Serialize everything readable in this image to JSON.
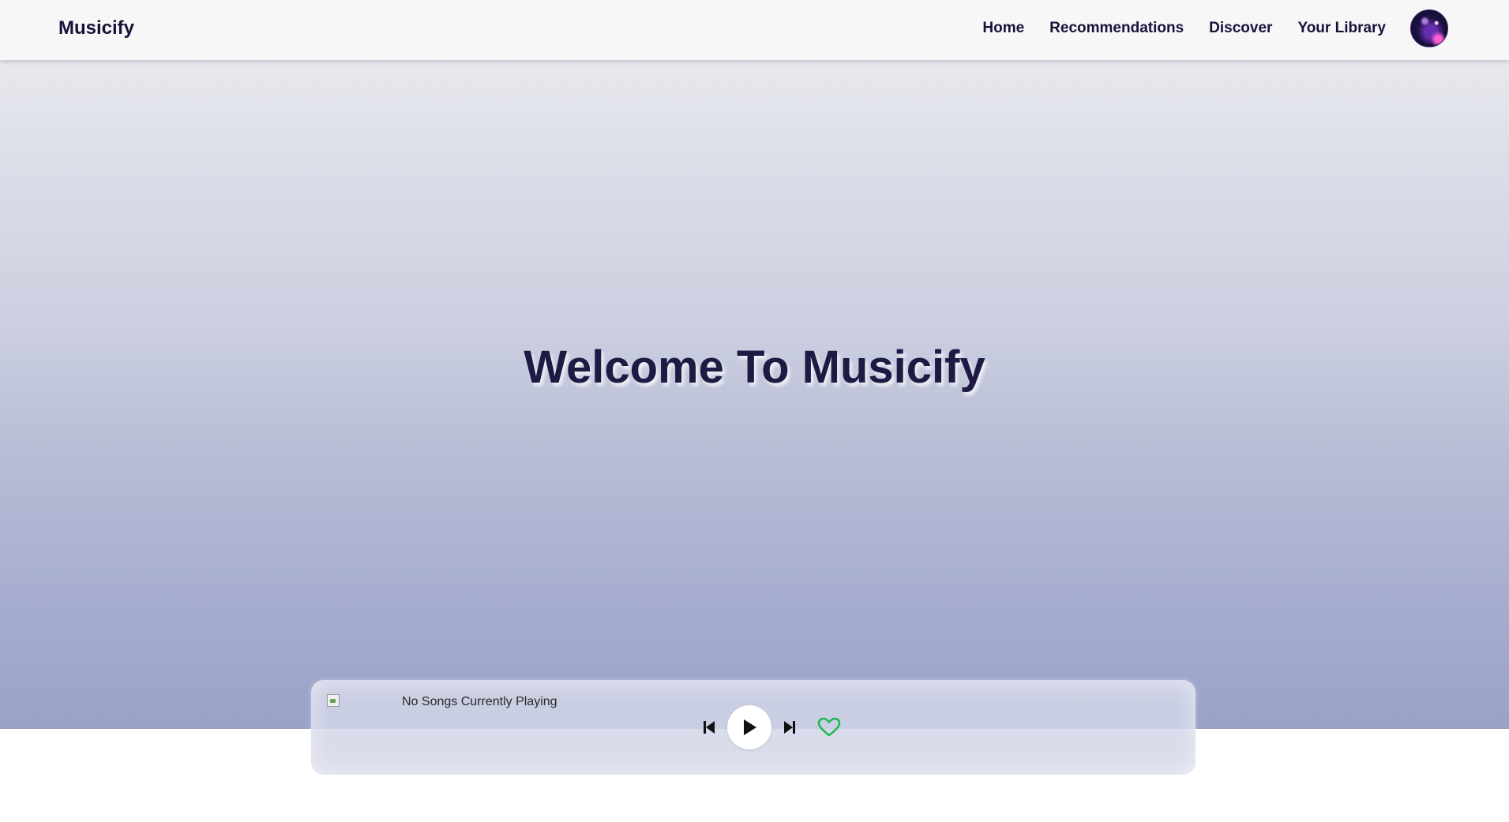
{
  "app": {
    "brand": "Musicify"
  },
  "nav": {
    "links": [
      {
        "label": "Home"
      },
      {
        "label": "Recommendations"
      },
      {
        "label": "Discover"
      },
      {
        "label": "Your Library"
      }
    ]
  },
  "hero": {
    "title": "Welcome To Musicify"
  },
  "player": {
    "status": "No Songs Currently Playing",
    "icons": {
      "previous": "skip-previous-icon",
      "play": "play-icon",
      "next": "skip-next-icon",
      "like": "heart-icon"
    },
    "like_color": "#1db954"
  },
  "colors": {
    "navbar_bg": "#f7f7f7",
    "text_dark": "#16133a",
    "hero_gradient_top": "#e8e9ee",
    "hero_gradient_bottom": "#9aa2c8",
    "accent_green": "#1db954"
  }
}
